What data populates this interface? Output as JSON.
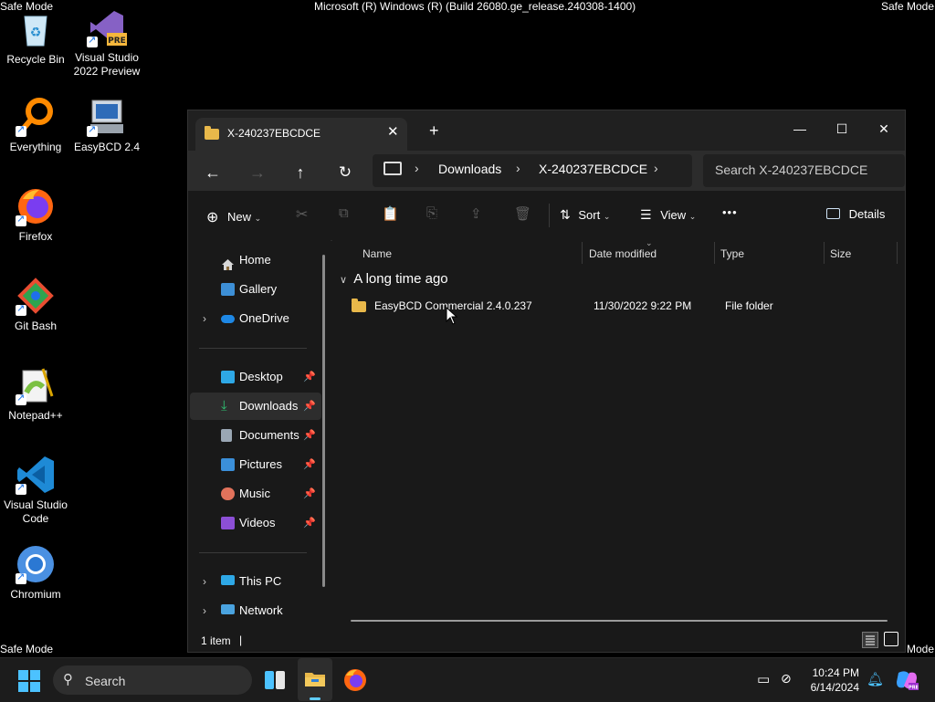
{
  "desktop": {
    "top_left_label": "Safe Mode",
    "top_right_label": "Safe Mode",
    "bottom_left_label": "Safe Mode",
    "bottom_right_label": "Safe Mode",
    "build_text": "Microsoft (R) Windows (R) (Build 26080.ge_release.240308-1400)",
    "icons": [
      {
        "label": "Recycle Bin",
        "icon": "recycle-bin-icon"
      },
      {
        "label": "Visual Studio 2022 Preview",
        "icon": "visual-studio-icon",
        "badge": "PRE"
      },
      {
        "label": "Everything",
        "icon": "everything-search-icon"
      },
      {
        "label": "EasyBCD 2.4",
        "icon": "easybcd-icon"
      },
      {
        "label": "Firefox",
        "icon": "firefox-icon"
      },
      {
        "label": "Git Bash",
        "icon": "git-bash-icon"
      },
      {
        "label": "Notepad++",
        "icon": "notepadpp-icon"
      },
      {
        "label": "Visual Studio Code",
        "icon": "vscode-icon"
      },
      {
        "label": "Chromium",
        "icon": "chromium-icon"
      }
    ]
  },
  "explorer": {
    "tab_title": "X-240237EBCDCE",
    "breadcrumb": [
      "Downloads",
      "X-240237EBCDCE"
    ],
    "search_placeholder": "Search X-240237EBCDCE",
    "toolbar": {
      "new_label": "New",
      "sort_label": "Sort",
      "view_label": "View",
      "details_label": "Details",
      "more_label": "•••"
    },
    "sidebar": {
      "top": [
        {
          "label": "Home",
          "icon": "home-icon"
        },
        {
          "label": "Gallery",
          "icon": "gallery-icon"
        },
        {
          "label": "OneDrive",
          "icon": "onedrive-icon"
        }
      ],
      "quick": [
        {
          "label": "Desktop",
          "icon": "desktop-folder-icon",
          "color": "#2ea8e6"
        },
        {
          "label": "Downloads",
          "icon": "downloads-folder-icon",
          "color": "#2fbf71"
        },
        {
          "label": "Documents",
          "icon": "documents-folder-icon",
          "color": "#9aa7b4"
        },
        {
          "label": "Pictures",
          "icon": "pictures-folder-icon",
          "color": "#3b8fd9"
        },
        {
          "label": "Music",
          "icon": "music-folder-icon",
          "color": "#e2725b"
        },
        {
          "label": "Videos",
          "icon": "videos-folder-icon",
          "color": "#8c4fd6"
        }
      ],
      "bottom": [
        {
          "label": "This PC",
          "icon": "this-pc-icon"
        },
        {
          "label": "Network",
          "icon": "network-icon"
        }
      ],
      "selected": "Downloads"
    },
    "columns": [
      "Name",
      "Date modified",
      "Type",
      "Size"
    ],
    "group_label": "A long time ago",
    "rows": [
      {
        "name": "EasyBCD Commercial 2.4.0.237",
        "date": "11/30/2022 9:22 PM",
        "type": "File folder",
        "size": ""
      }
    ],
    "status_text": "1 item",
    "status_separator": "|"
  },
  "taskbar": {
    "search_label": "Search",
    "time": "10:24 PM",
    "date": "6/14/2024"
  },
  "colors": {
    "accent": "#60cdff",
    "folder": "#e8b84a",
    "taskbar": "#1c1c1c"
  }
}
